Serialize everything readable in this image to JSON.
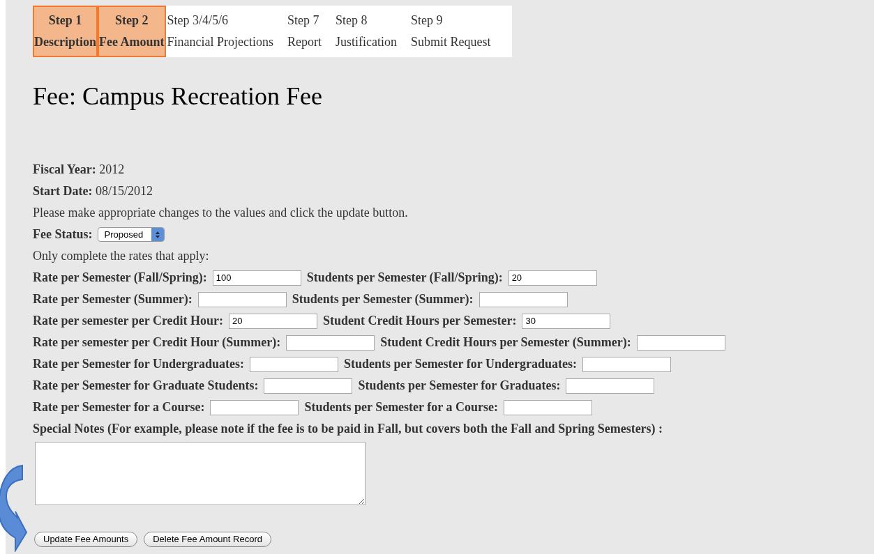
{
  "steps": [
    {
      "number": "Step 1",
      "name": "Description",
      "selected": true
    },
    {
      "number": "Step 2",
      "name": "Fee Amount",
      "selected": true
    },
    {
      "number": "Step 3/4/5/6",
      "name": "Financial Projections",
      "selected": false
    },
    {
      "number": "Step 7",
      "name": "Report",
      "selected": false
    },
    {
      "number": "Step 8",
      "name": "Justification",
      "selected": false
    },
    {
      "number": "Step 9",
      "name": "Submit Request",
      "selected": false
    }
  ],
  "title": "Fee: Campus Recreation Fee",
  "fiscal_year": {
    "label": "Fiscal Year:",
    "value": "2012"
  },
  "start_date": {
    "label": "Start Date:",
    "value": "08/15/2012"
  },
  "instruction": "Please make appropriate changes to the values and click the update button.",
  "fee_status": {
    "label": "Fee Status:",
    "value": "Proposed"
  },
  "rates_note": "Only complete the rates that apply:",
  "rate_rows": [
    {
      "rate_label": "Rate per Semester (Fall/Spring):",
      "rate_value": "100",
      "students_label": "Students per Semester (Fall/Spring):",
      "students_value": "20"
    },
    {
      "rate_label": "Rate per Semester (Summer):",
      "students_label": "Students per Semester (Summer):"
    },
    {
      "rate_label": "Rate per semester per Credit Hour:",
      "rate_value": "20",
      "students_label": "Student Credit Hours per Semester:",
      "students_value": "30"
    },
    {
      "rate_label": "Rate per semester per Credit Hour (Summer):",
      "students_label": "Student Credit Hours per Semester (Summer):"
    },
    {
      "rate_label": "Rate per Semester for Undergraduates:",
      "students_label": "Students per Semester for Undergraduates:"
    },
    {
      "rate_label": "Rate per Semester for Graduate Students:",
      "students_label": "Students per Semester for Graduates:"
    },
    {
      "rate_label": "Rate per Semester for a Course:",
      "students_label": "Students per Semester for a Course:"
    }
  ],
  "special_notes": {
    "label": "Special Notes (For example, please note if the fee is to be paid in Fall, but covers both the Fall and Spring Semesters) :"
  },
  "buttons": [
    "Update Fee Amounts",
    "Delete Fee Amount Record"
  ]
}
